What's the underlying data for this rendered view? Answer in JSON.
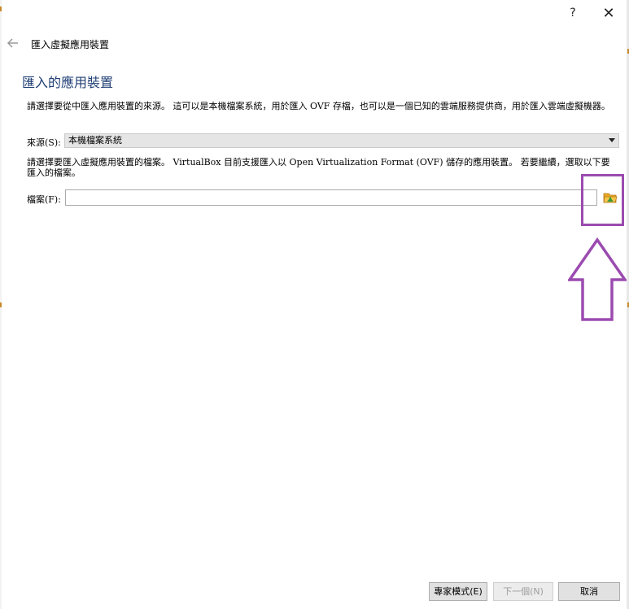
{
  "titlebar": {
    "help_label": "?",
    "close_label": "✕"
  },
  "wizard": {
    "title": "匯入虛擬應用裝置",
    "heading": "匯入的應用裝置",
    "source_description": "請選擇要從中匯入應用裝置的來源。 這可以是本機檔案系統，用於匯入 OVF 存檔，也可以是一個已知的雲端服務提供商，用於匯入雲端虛擬機器。",
    "source_label": "來源(S):",
    "source_selected": "本機檔案系統",
    "file_description": "請選擇要匯入虛擬應用裝置的檔案。 VirtualBox 目前支援匯入以 Open Virtualization Format (OVF) 儲存的應用裝置。 若要繼續，選取以下要匯入的檔案。",
    "file_label": "檔案(F):",
    "file_value": "",
    "browse_icon": "folder-open-icon"
  },
  "buttons": {
    "expert_mode": "專家模式(E)",
    "next": "下一個(N)",
    "cancel": "取消"
  },
  "annotation": {
    "color": "#9b4bb0"
  },
  "colors": {
    "heading": "#1f3e74",
    "button_bg": "#e1e1e1"
  }
}
